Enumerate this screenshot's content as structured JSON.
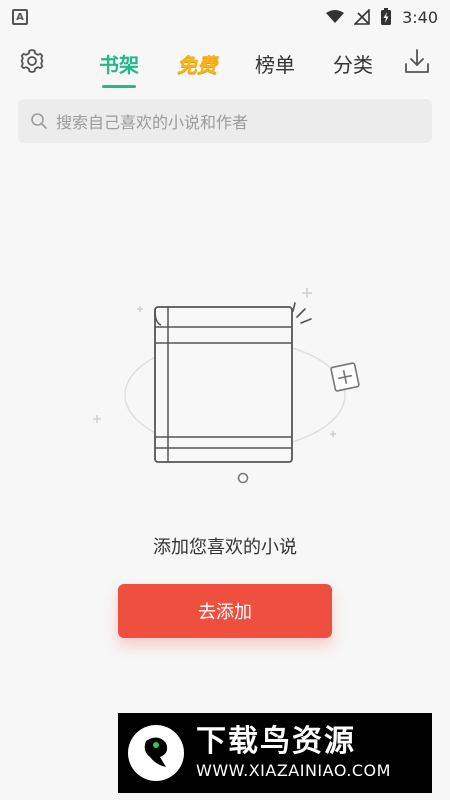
{
  "status_bar": {
    "time": "3:40",
    "left_icon": "A"
  },
  "nav": {
    "settings_icon": "gear-icon",
    "download_icon": "download-icon",
    "tabs": [
      {
        "label": "书架",
        "active": true
      },
      {
        "label": "免费",
        "active": false
      },
      {
        "label": "榜单",
        "active": false
      },
      {
        "label": "分类",
        "active": false
      }
    ],
    "accent_color": "#25b88c",
    "free_color": "#f3b51b"
  },
  "search": {
    "placeholder": "搜索自己喜欢的小说和作者"
  },
  "empty_state": {
    "message": "添加您喜欢的小说",
    "button_label": "去添加",
    "button_color": "#ef4f3e"
  },
  "watermark": {
    "title": "下载鸟资源",
    "url": "WWW.XIAZAINIAO.COM"
  }
}
